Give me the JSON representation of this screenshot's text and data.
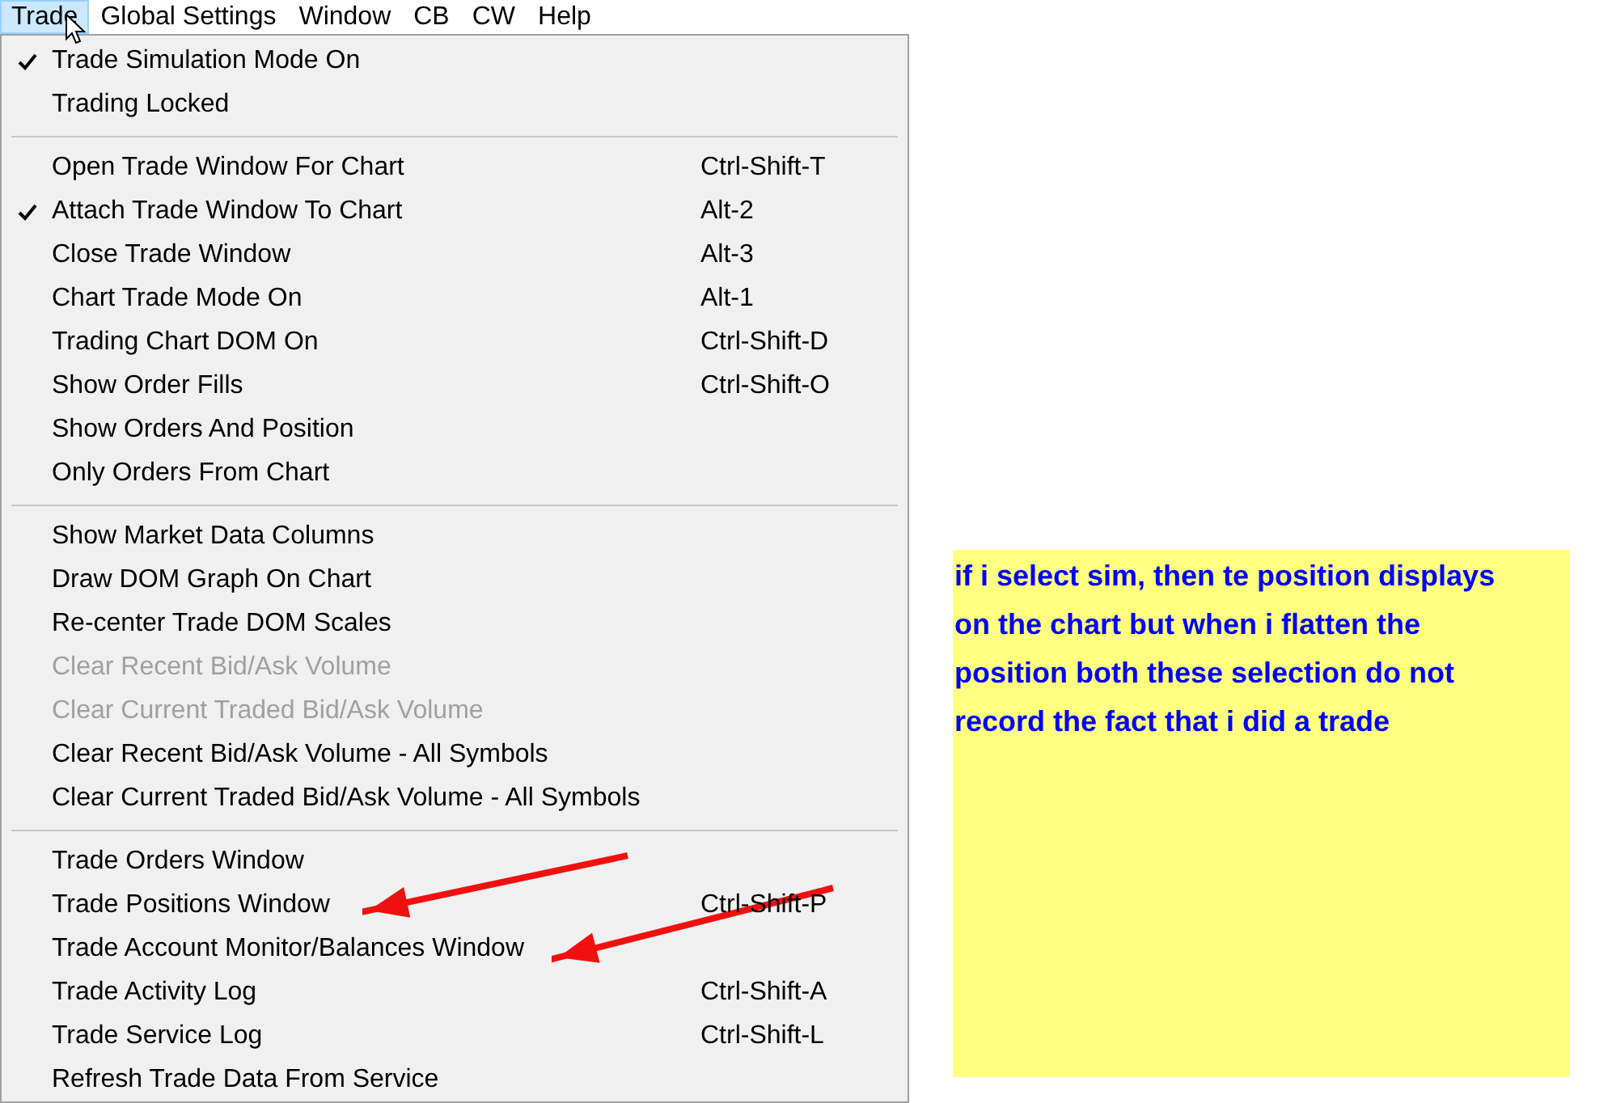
{
  "menu_bar": [
    {
      "label": "Trade",
      "selected": true
    },
    {
      "label": "Global Settings",
      "selected": false
    },
    {
      "label": "Window",
      "selected": false
    },
    {
      "label": "CB",
      "selected": false
    },
    {
      "label": "CW",
      "selected": false
    },
    {
      "label": "Help",
      "selected": false
    }
  ],
  "menu": {
    "sections": [
      [
        {
          "label": "Trade Simulation Mode On",
          "checked": true,
          "disabled": false
        },
        {
          "label": "Trading Locked",
          "checked": false,
          "disabled": false
        }
      ],
      [
        {
          "label": "Open Trade Window For Chart",
          "shortcut": "Ctrl-Shift-T",
          "checked": false,
          "disabled": false
        },
        {
          "label": "Attach Trade Window To Chart",
          "shortcut": "Alt-2",
          "checked": true,
          "disabled": false
        },
        {
          "label": "Close Trade Window",
          "shortcut": "Alt-3",
          "checked": false,
          "disabled": false
        },
        {
          "label": "Chart Trade Mode On",
          "shortcut": "Alt-1",
          "checked": false,
          "disabled": false
        },
        {
          "label": "Trading Chart DOM On",
          "shortcut": "Ctrl-Shift-D",
          "checked": false,
          "disabled": false
        },
        {
          "label": "Show Order Fills",
          "shortcut": "Ctrl-Shift-O",
          "checked": false,
          "disabled": false
        },
        {
          "label": "Show Orders And Position",
          "checked": false,
          "disabled": false
        },
        {
          "label": "Only Orders From Chart",
          "checked": false,
          "disabled": false
        }
      ],
      [
        {
          "label": "Show Market Data Columns",
          "checked": false,
          "disabled": false
        },
        {
          "label": "Draw DOM Graph On Chart",
          "checked": false,
          "disabled": false
        },
        {
          "label": "Re-center Trade DOM Scales",
          "checked": false,
          "disabled": false
        },
        {
          "label": "Clear Recent Bid/Ask Volume",
          "checked": false,
          "disabled": true
        },
        {
          "label": "Clear Current Traded Bid/Ask Volume",
          "checked": false,
          "disabled": true
        },
        {
          "label": "Clear Recent Bid/Ask Volume - All Symbols",
          "checked": false,
          "disabled": false
        },
        {
          "label": "Clear Current Traded Bid/Ask Volume - All Symbols",
          "checked": false,
          "disabled": false
        }
      ],
      [
        {
          "label": "Trade Orders Window",
          "checked": false,
          "disabled": false
        },
        {
          "label": "Trade Positions Window",
          "shortcut": "Ctrl-Shift-P",
          "checked": false,
          "disabled": false
        },
        {
          "label": "Trade Account Monitor/Balances Window",
          "checked": false,
          "disabled": false
        },
        {
          "label": "Trade Activity Log",
          "shortcut": "Ctrl-Shift-A",
          "checked": false,
          "disabled": false
        },
        {
          "label": "Trade Service Log",
          "shortcut": "Ctrl-Shift-L",
          "checked": false,
          "disabled": false
        },
        {
          "label": "Refresh Trade Data From Service",
          "checked": false,
          "disabled": false
        }
      ]
    ]
  },
  "note": {
    "text": "if i select sim, then te position displays on the chart but when i flatten the position both these selection do not record the fact that i did a trade"
  }
}
